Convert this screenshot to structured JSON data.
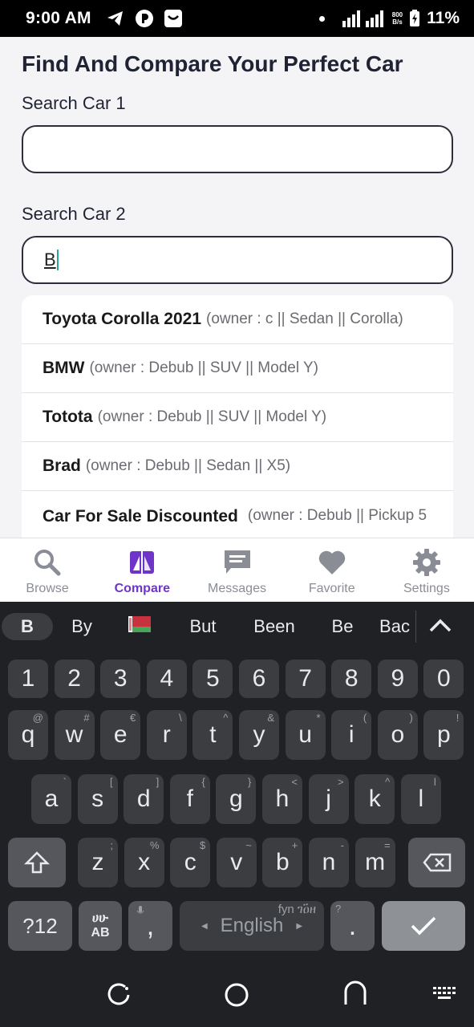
{
  "status_bar": {
    "time": "9:00 AM",
    "speed_top": "800",
    "speed_bottom": "B/s",
    "battery": "11%"
  },
  "page": {
    "title": "Find And Compare Your Perfect Car",
    "search1": {
      "label": "Search Car 1",
      "value": ""
    },
    "search2": {
      "label": "Search Car 2",
      "value": "B"
    }
  },
  "results": [
    {
      "name": "Toyota Corolla 2021",
      "meta": "(owner : c || Sedan || Corolla)"
    },
    {
      "name": "BMW",
      "meta": "(owner : Debub || SUV || Model Y)"
    },
    {
      "name": "Totota",
      "meta": "(owner : Debub || SUV || Model Y)"
    },
    {
      "name": "Brad",
      "meta": "(owner : Debub || Sedan || X5)"
    },
    {
      "name": "Car For Sale Discounted",
      "meta": "(owner : Debub || Pickup 5"
    }
  ],
  "bottom_nav": {
    "active_color": "#6f35c8",
    "items": [
      {
        "label": "Browse",
        "icon": "search-icon"
      },
      {
        "label": "Compare",
        "icon": "compare-icon"
      },
      {
        "label": "Messages",
        "icon": "message-icon"
      },
      {
        "label": "Favorite",
        "icon": "heart-icon"
      },
      {
        "label": "Settings",
        "icon": "gear-icon"
      }
    ]
  },
  "keyboard": {
    "suggestions": [
      "B",
      "By",
      "But",
      "Been",
      "Be",
      "Bac"
    ],
    "numbers": [
      "1",
      "2",
      "3",
      "4",
      "5",
      "6",
      "7",
      "8",
      "9",
      "0"
    ],
    "row1": [
      [
        "q",
        "@"
      ],
      [
        "w",
        "#"
      ],
      [
        "e",
        "€"
      ],
      [
        "r",
        "\\"
      ],
      [
        "t",
        "^"
      ],
      [
        "y",
        "&"
      ],
      [
        "u",
        "*"
      ],
      [
        "i",
        "("
      ],
      [
        "o",
        ")"
      ],
      [
        "p",
        "!"
      ]
    ],
    "row2": [
      [
        "a",
        "`"
      ],
      [
        "s",
        "["
      ],
      [
        "d",
        "]"
      ],
      [
        "f",
        "{"
      ],
      [
        "g",
        "}"
      ],
      [
        "h",
        "<"
      ],
      [
        "j",
        ">"
      ],
      [
        "k",
        "^"
      ],
      [
        "l",
        "l"
      ]
    ],
    "row3": [
      [
        "z",
        ";"
      ],
      [
        "x",
        "%"
      ],
      [
        "c",
        "$"
      ],
      [
        "v",
        "~"
      ],
      [
        "b",
        "+"
      ],
      [
        "n",
        "-"
      ],
      [
        "m",
        "="
      ]
    ],
    "symbols_key": "?12",
    "lang_key_top": "ሀሁ",
    "lang_key_bottom": "AB",
    "comma": ",",
    "space_label": "English",
    "space_hint": "fyn ገዐ፟ዘ",
    "period": ".",
    "period_hint": "?"
  }
}
